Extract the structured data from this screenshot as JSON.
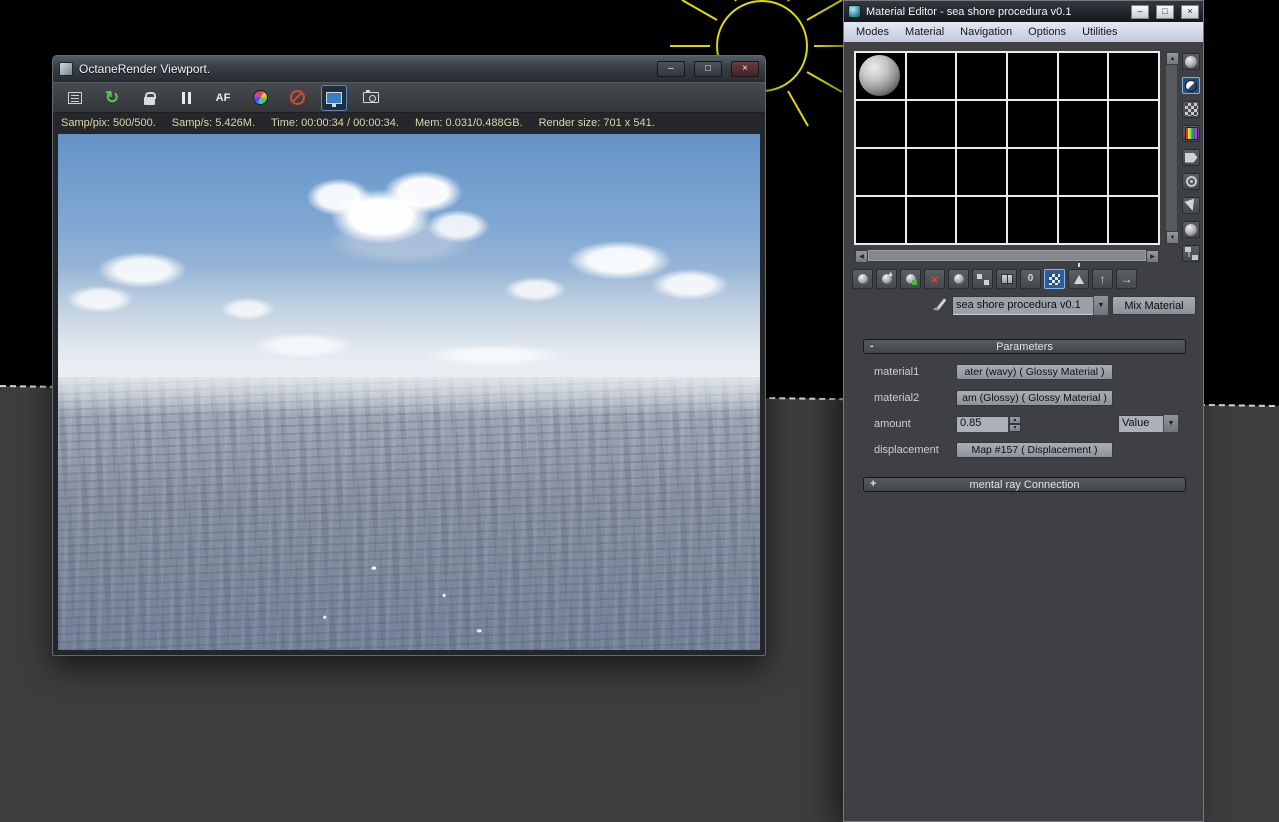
{
  "glyphs": {
    "minimize": "–",
    "maximize": "□",
    "close": "×",
    "up": "▲",
    "down": "▼",
    "left": "◀",
    "right": "▶",
    "refresh": "↻",
    "cross": "×",
    "parent_arrow": "↑",
    "sibling_arrow": "→",
    "material_id": "0",
    "combo_arrow": "▼"
  },
  "viewport": {
    "title": "OctaneRender Viewport.",
    "toolbar": {
      "af_label": "AF"
    },
    "status": {
      "samp_pix": "Samp/pix: 500/500.",
      "samp_rate": "Samp/s: 5.426M.",
      "time": "Time: 00:00:34 / 00:00:34.",
      "mem": "Mem: 0.031/0.488GB.",
      "render_size": "Render size: 701 x 541."
    }
  },
  "material_editor": {
    "title": "Material Editor - sea shore procedura v0.1",
    "menu": {
      "items": [
        "Modes",
        "Material",
        "Navigation",
        "Options",
        "Utilities"
      ]
    },
    "name_field": {
      "value": "sea shore procedura v0.1"
    },
    "type_button_label": "Mix Material",
    "parameters": {
      "collapse_glyph": "-",
      "title": "Parameters",
      "material1_label": "material1",
      "material1_value": "ater (wavy)  ( Glossy Material )",
      "material2_label": "material2",
      "material2_value": "am (Glossy)  ( Glossy Material )",
      "amount_label": "amount",
      "amount_value": "0.85",
      "amount_mode": "Value",
      "displacement_label": "displacement",
      "displacement_value": "Map #157  ( Displacement )"
    },
    "mental_ray": {
      "collapse_glyph": "+",
      "title": "mental ray Connection"
    }
  }
}
